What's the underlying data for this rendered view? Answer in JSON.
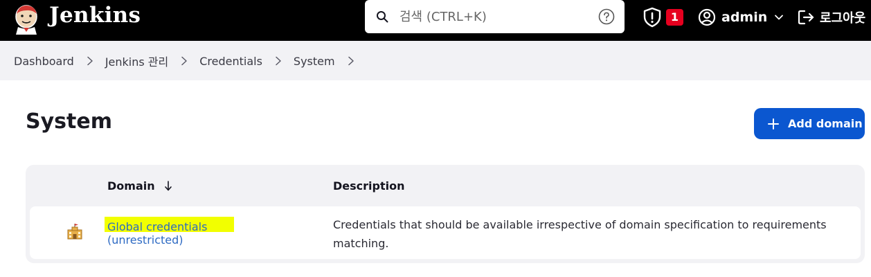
{
  "header": {
    "brand": "Jenkins",
    "search": {
      "placeholder": "검색 (CTRL+K)"
    },
    "alert_count": "1",
    "user": "admin",
    "logout": "로그아웃"
  },
  "breadcrumb": [
    "Dashboard",
    "Jenkins 관리",
    "Credentials",
    "System"
  ],
  "page": {
    "title": "System",
    "add_domain": "Add domain"
  },
  "table": {
    "columns": {
      "domain": "Domain",
      "description": "Description"
    },
    "rows": [
      {
        "domain": "Global credentials",
        "scope": "(unrestricted)",
        "description": "Credentials that should be available irrespective of domain specification to requirements matching."
      }
    ]
  },
  "colors": {
    "header_bg": "#000000",
    "accent_button": "#0b57d0",
    "link": "#2d6ac3",
    "badge": "#e6001f",
    "highlight": "#f2ff00"
  },
  "icons": [
    "jenkins-logo-icon",
    "search-icon",
    "help-icon",
    "shield-alert-icon",
    "user-icon",
    "chevron-down-icon",
    "logout-icon",
    "chevron-right-icon",
    "plus-icon",
    "sort-down-arrow-icon",
    "credentials-domain-icon"
  ]
}
